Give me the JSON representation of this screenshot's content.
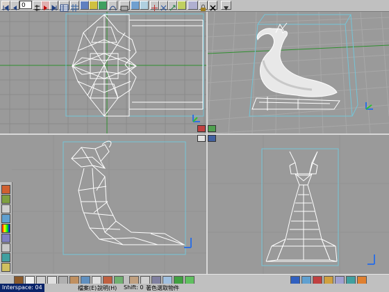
{
  "toolbar": {
    "frame_value": "0"
  },
  "status": {
    "workspace": "Interspace: 04",
    "file_menu": "檔案(E)",
    "help_menu": "說明(H)",
    "shift_readout": "Shift: 0",
    "hint": "著色選取物件"
  },
  "colors": {
    "viewport_bg": "#9a9a9a",
    "grid": "#8b8b8b",
    "axis_green": "#2f8f2f",
    "wire": "#ffffff",
    "bbox_cyan": "#74c5d8",
    "divider": "#d8d8d8",
    "workspace_bg": "#0a246a"
  },
  "icons": {
    "top_toolbar": [
      "rewind-icon",
      "prev-frame-icon",
      "frame-input",
      "next-frame-icon",
      "play-icon",
      "stop-icon",
      "spreadsheet-icon",
      "grid-icon",
      "camera-icon",
      "light-icon",
      "object-icon",
      "path-icon",
      "scene-icon",
      "render-icon",
      "link-icon",
      "move-icon",
      "rotate-icon",
      "scale-icon",
      "snap-icon",
      "ik-icon",
      "lock-icon",
      "close-icon",
      "undo-icon",
      "down-arrow-icon"
    ],
    "left_palette": [
      "sphere-icon",
      "texture-icon",
      "bend-icon",
      "deform-icon",
      "color-icon",
      "cube-icon",
      "plane-icon",
      "cone-icon",
      "light-bulb-icon",
      "camera-small-icon"
    ],
    "bottom_toolbar": [
      "cube-primitive-icon",
      "sphere-primitive-icon",
      "cylinder-primitive-icon",
      "cone-primitive-icon",
      "torus-primitive-icon",
      "material-icon",
      "wire-icon",
      "sculpt-icon",
      "paint-icon",
      "particle-icon",
      "edit-icon",
      "extrude-icon",
      "lathe-icon",
      "sweep-icon",
      "text-icon",
      "select-icon",
      "pointer-icon",
      "move-tool-icon",
      "rotate-tool-icon",
      "scale-tool-icon",
      "zoom-tool-icon",
      "pan-tool-icon",
      "orbit-tool-icon"
    ]
  }
}
